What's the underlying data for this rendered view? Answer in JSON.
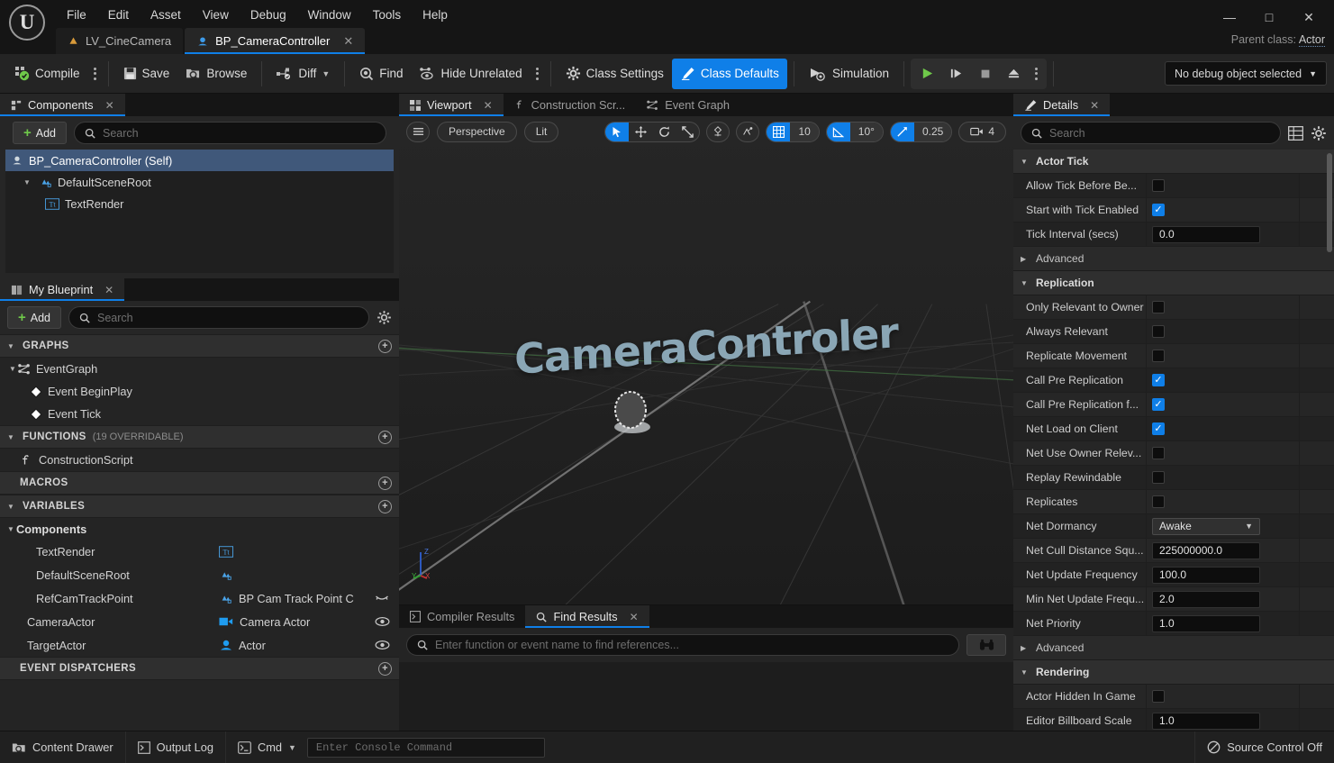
{
  "window": {
    "logo": "unreal-engine-logo",
    "parent_class_label": "Parent class:",
    "parent_class_value": "Actor",
    "minimize": "—",
    "maximize": "□",
    "close": "✕"
  },
  "menubar": {
    "items": [
      "File",
      "Edit",
      "Asset",
      "View",
      "Debug",
      "Window",
      "Tools",
      "Help"
    ]
  },
  "document_tabs": [
    {
      "label": "LV_CineCamera",
      "icon": "level-icon",
      "active": false,
      "closable": false
    },
    {
      "label": "BP_CameraController",
      "icon": "blueprint-icon",
      "active": true,
      "closable": true,
      "close": "✕"
    }
  ],
  "toolbar": {
    "compile": "Compile",
    "save": "Save",
    "browse": "Browse",
    "diff": "Diff",
    "find": "Find",
    "hide_unrelated": "Hide Unrelated",
    "class_settings": "Class Settings",
    "class_defaults": "Class Defaults",
    "simulation": "Simulation",
    "debug_object": "No debug object selected",
    "accent": "#0f7fe8"
  },
  "components_panel": {
    "tab_label": "Components",
    "tab_close": "✕",
    "add_label": "Add",
    "search_placeholder": "Search",
    "tree": [
      {
        "label": "BP_CameraController (Self)",
        "indent": 0,
        "icon": "blueprint-icon",
        "selected": true,
        "arrow": ""
      },
      {
        "label": "DefaultSceneRoot",
        "indent": 1,
        "icon": "scene-root-icon",
        "selected": false,
        "arrow": "▼"
      },
      {
        "label": "TextRender",
        "indent": 2,
        "icon": "text-render-icon",
        "selected": false,
        "arrow": ""
      }
    ]
  },
  "my_blueprint": {
    "tab_label": "My Blueprint",
    "tab_close": "✕",
    "add_label": "Add",
    "search_placeholder": "Search",
    "sections": [
      {
        "title": "GRAPHS",
        "sub": "",
        "expanded": true,
        "items": [
          {
            "label": "EventGraph",
            "indent": 0,
            "icon": "graph-icon",
            "arrow": "▼"
          },
          {
            "label": "Event BeginPlay",
            "indent": 1,
            "icon": "event-node-icon",
            "arrow": ""
          },
          {
            "label": "Event Tick",
            "indent": 1,
            "icon": "event-node-icon",
            "arrow": ""
          }
        ]
      },
      {
        "title": "FUNCTIONS",
        "sub": "(19 OVERRIDABLE)",
        "expanded": true,
        "items": [
          {
            "label": "ConstructionScript",
            "indent": 0,
            "icon": "function-icon",
            "arrow": ""
          }
        ]
      },
      {
        "title": "MACROS",
        "sub": "",
        "expanded": false,
        "items": []
      },
      {
        "title": "VARIABLES",
        "sub": "",
        "expanded": true,
        "items": []
      }
    ],
    "variables_group": "Components",
    "variables": [
      {
        "name": "TextRender",
        "type": "",
        "icon": "text-render-icon",
        "eye": "",
        "indent": 2
      },
      {
        "name": "DefaultSceneRoot",
        "type": "",
        "icon": "scene-root-icon",
        "eye": "",
        "indent": 2
      },
      {
        "name": "RefCamTrackPoint",
        "type": "BP Cam Track Point C",
        "icon": "scene-root-icon",
        "eye": "eye-closed-icon",
        "indent": 2
      },
      {
        "name": "CameraActor",
        "type": "Camera Actor",
        "icon": "camera-actor-icon",
        "eye": "eye-open-icon",
        "indent": 1
      },
      {
        "name": "TargetActor",
        "type": "Actor",
        "icon": "actor-icon",
        "eye": "eye-open-icon",
        "indent": 1
      }
    ],
    "event_dispatchers": "EVENT DISPATCHERS"
  },
  "center_tabs": [
    {
      "label": "Viewport",
      "icon": "viewport-icon",
      "active": true,
      "close": "✕"
    },
    {
      "label": "Construction Scr...",
      "icon": "function-icon",
      "active": false
    },
    {
      "label": "Event Graph",
      "icon": "graph-icon",
      "active": false
    }
  ],
  "viewport": {
    "menu_icon": "hamburger-icon",
    "camera_mode": "Perspective",
    "view_mode": "Lit",
    "transform_tools": [
      "select-icon",
      "move-icon",
      "rotate-icon",
      "scale-icon"
    ],
    "coord_tools": [
      "world-space-icon",
      "surface-snap-icon"
    ],
    "grid_snap_value": "10",
    "angle_snap_value": "10°",
    "scale_snap_value": "0.25",
    "camera_speed_value": "4",
    "scene_text": "CameraControler",
    "scene_text_color": "#8aa6b5",
    "axis_labels": {
      "z": "Z",
      "y": "Y",
      "x": "X"
    }
  },
  "results_panel": {
    "tabs": [
      {
        "label": "Compiler Results",
        "icon": "compiler-icon",
        "active": false
      },
      {
        "label": "Find Results",
        "icon": "search-icon",
        "active": true,
        "close": "✕"
      }
    ],
    "find_placeholder": "Enter function or event name to find references...",
    "find_button_icon": "binoculars-icon"
  },
  "details": {
    "tab_label": "Details",
    "tab_close": "✕",
    "search_placeholder": "Search",
    "grid_icon": "grid-view-icon",
    "settings_icon": "gear-icon",
    "groups": [
      {
        "title": "Actor Tick",
        "kind": "category",
        "expanded": true,
        "rows": [
          {
            "label": "Allow Tick Before Be...",
            "type": "checkbox",
            "checked": false
          },
          {
            "label": "Start with Tick Enabled",
            "type": "checkbox",
            "checked": true
          },
          {
            "label": "Tick Interval (secs)",
            "type": "number",
            "value": "0.0"
          }
        ]
      },
      {
        "title": "Advanced",
        "kind": "subcategory",
        "expanded": false,
        "rows": []
      },
      {
        "title": "Replication",
        "kind": "category",
        "expanded": true,
        "rows": [
          {
            "label": "Only Relevant to Owner",
            "type": "checkbox",
            "checked": false
          },
          {
            "label": "Always Relevant",
            "type": "checkbox",
            "checked": false
          },
          {
            "label": "Replicate Movement",
            "type": "checkbox",
            "checked": false
          },
          {
            "label": "Call Pre Replication",
            "type": "checkbox",
            "checked": true
          },
          {
            "label": "Call Pre Replication f...",
            "type": "checkbox",
            "checked": true
          },
          {
            "label": "Net Load on Client",
            "type": "checkbox",
            "checked": true
          },
          {
            "label": "Net Use Owner Relev...",
            "type": "checkbox",
            "checked": false
          },
          {
            "label": "Replay Rewindable",
            "type": "checkbox",
            "checked": false
          },
          {
            "label": "Replicates",
            "type": "checkbox",
            "checked": false
          },
          {
            "label": "Net Dormancy",
            "type": "dropdown",
            "value": "Awake"
          },
          {
            "label": "Net Cull Distance Squ...",
            "type": "number",
            "value": "225000000.0"
          },
          {
            "label": "Net Update Frequency",
            "type": "number",
            "value": "100.0"
          },
          {
            "label": "Min Net Update Frequ...",
            "type": "number",
            "value": "2.0"
          },
          {
            "label": "Net Priority",
            "type": "number",
            "value": "1.0"
          }
        ]
      },
      {
        "title": "Advanced",
        "kind": "subcategory",
        "expanded": false,
        "rows": []
      },
      {
        "title": "Rendering",
        "kind": "category",
        "expanded": true,
        "rows": [
          {
            "label": "Actor Hidden In Game",
            "type": "checkbox",
            "checked": false
          },
          {
            "label": "Editor Billboard Scale",
            "type": "number",
            "value": "1.0"
          }
        ]
      }
    ]
  },
  "statusbar": {
    "content_drawer": "Content Drawer",
    "output_log": "Output Log",
    "cmd": "Cmd",
    "console_placeholder": "Enter Console Command",
    "source_control": "Source Control Off"
  }
}
